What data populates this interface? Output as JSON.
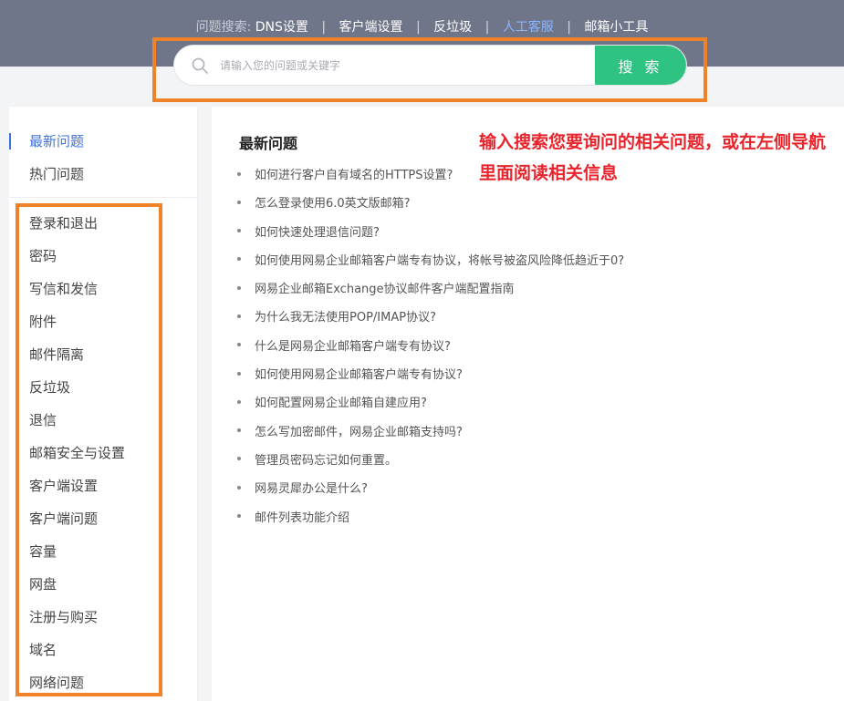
{
  "header": {
    "prefix": "问题搜索:",
    "links": [
      "DNS设置",
      "客户端设置",
      "反垃圾",
      "人工客服",
      "邮箱小工具"
    ],
    "separator": "|"
  },
  "search": {
    "placeholder": "请输入您的问题或关键字",
    "button_label": "搜 索"
  },
  "sidebar": {
    "top_items": [
      "最新问题",
      "热门问题"
    ],
    "categories": [
      "登录和退出",
      "密码",
      "写信和发信",
      "附件",
      "邮件隔离",
      "反垃圾",
      "退信",
      "邮箱安全与设置",
      "客户端设置",
      "客户端问题",
      "容量",
      "网盘",
      "注册与购买",
      "域名",
      "网络问题"
    ]
  },
  "main": {
    "title": "最新问题",
    "questions": [
      "如何进行客户自有域名的HTTPS设置?",
      "怎么登录使用6.0英文版邮箱?",
      "如何快速处理退信问题?",
      "如何使用网易企业邮箱客户端专有协议，将帐号被盗风险降低趋近于0?",
      "网易企业邮箱Exchange协议邮件客户端配置指南",
      "为什么我无法使用POP/IMAP协议?",
      "什么是网易企业邮箱客户端专有协议?",
      "如何使用网易企业邮箱客户端专有协议?",
      "如何配置网易企业邮箱自建应用?",
      "怎么写加密邮件，网易企业邮箱支持吗?",
      "管理员密码忘记如何重置。",
      "网易灵犀办公是什么?",
      "邮件列表功能介绍"
    ]
  },
  "annotation": "输入搜索您要询问的相关问题，或在左侧导航里面阅读相关信息",
  "colors": {
    "header_bg": "#70768a",
    "search_button": "#2ec283",
    "highlight_frame": "#f0822a",
    "annotation_text": "#e8242c",
    "active_link": "#3f73d8"
  }
}
